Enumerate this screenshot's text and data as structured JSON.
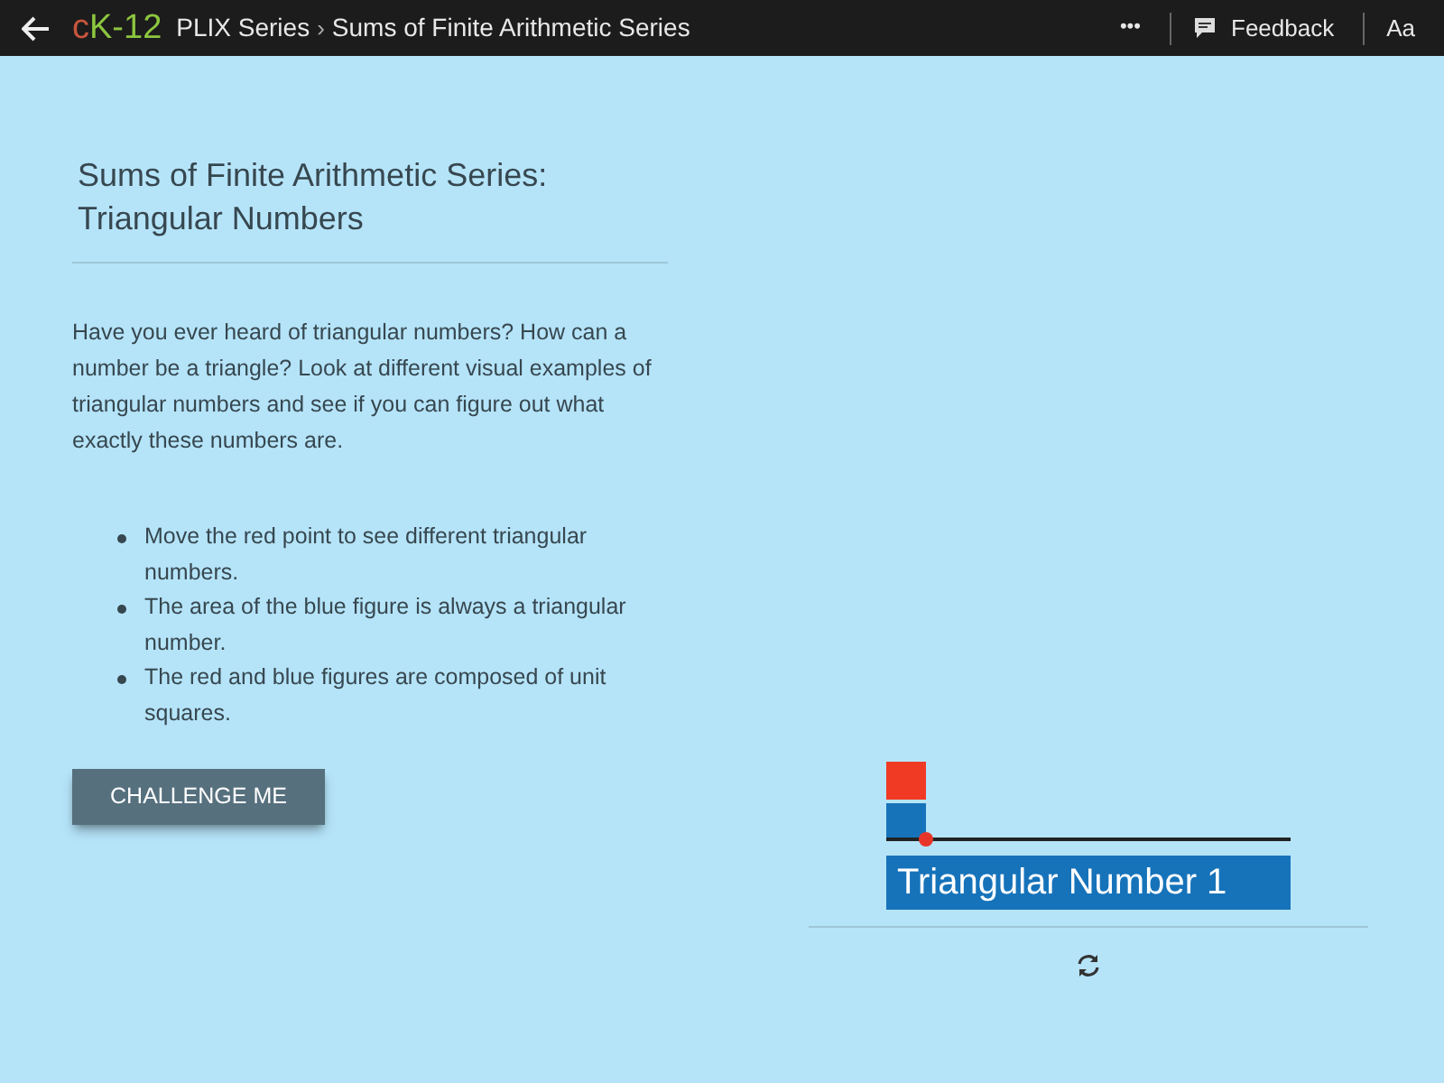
{
  "header": {
    "logo": {
      "prefix": "c",
      "rest": "K-12"
    },
    "breadcrumb": [
      "PLIX Series",
      "Sums of Finite Arithmetic Series"
    ],
    "separator": "›",
    "more": "•••",
    "feedback": "Feedback",
    "font_size": "Aa"
  },
  "title": "Sums of Finite Arithmetic Series: Triangular Numbers",
  "intro": "Have you ever heard of triangular numbers? How can a number be a triangle? Look at different visual examples of triangular numbers and see if you can figure out what exactly these numbers are.",
  "instructions": [
    "Move the red point to see different triangular numbers.",
    "The area of the blue figure is always a triangular number.",
    "The red and blue figures are composed of unit squares."
  ],
  "button": "CHALLENGE ME",
  "interactive": {
    "label": "Triangular Number 1"
  }
}
